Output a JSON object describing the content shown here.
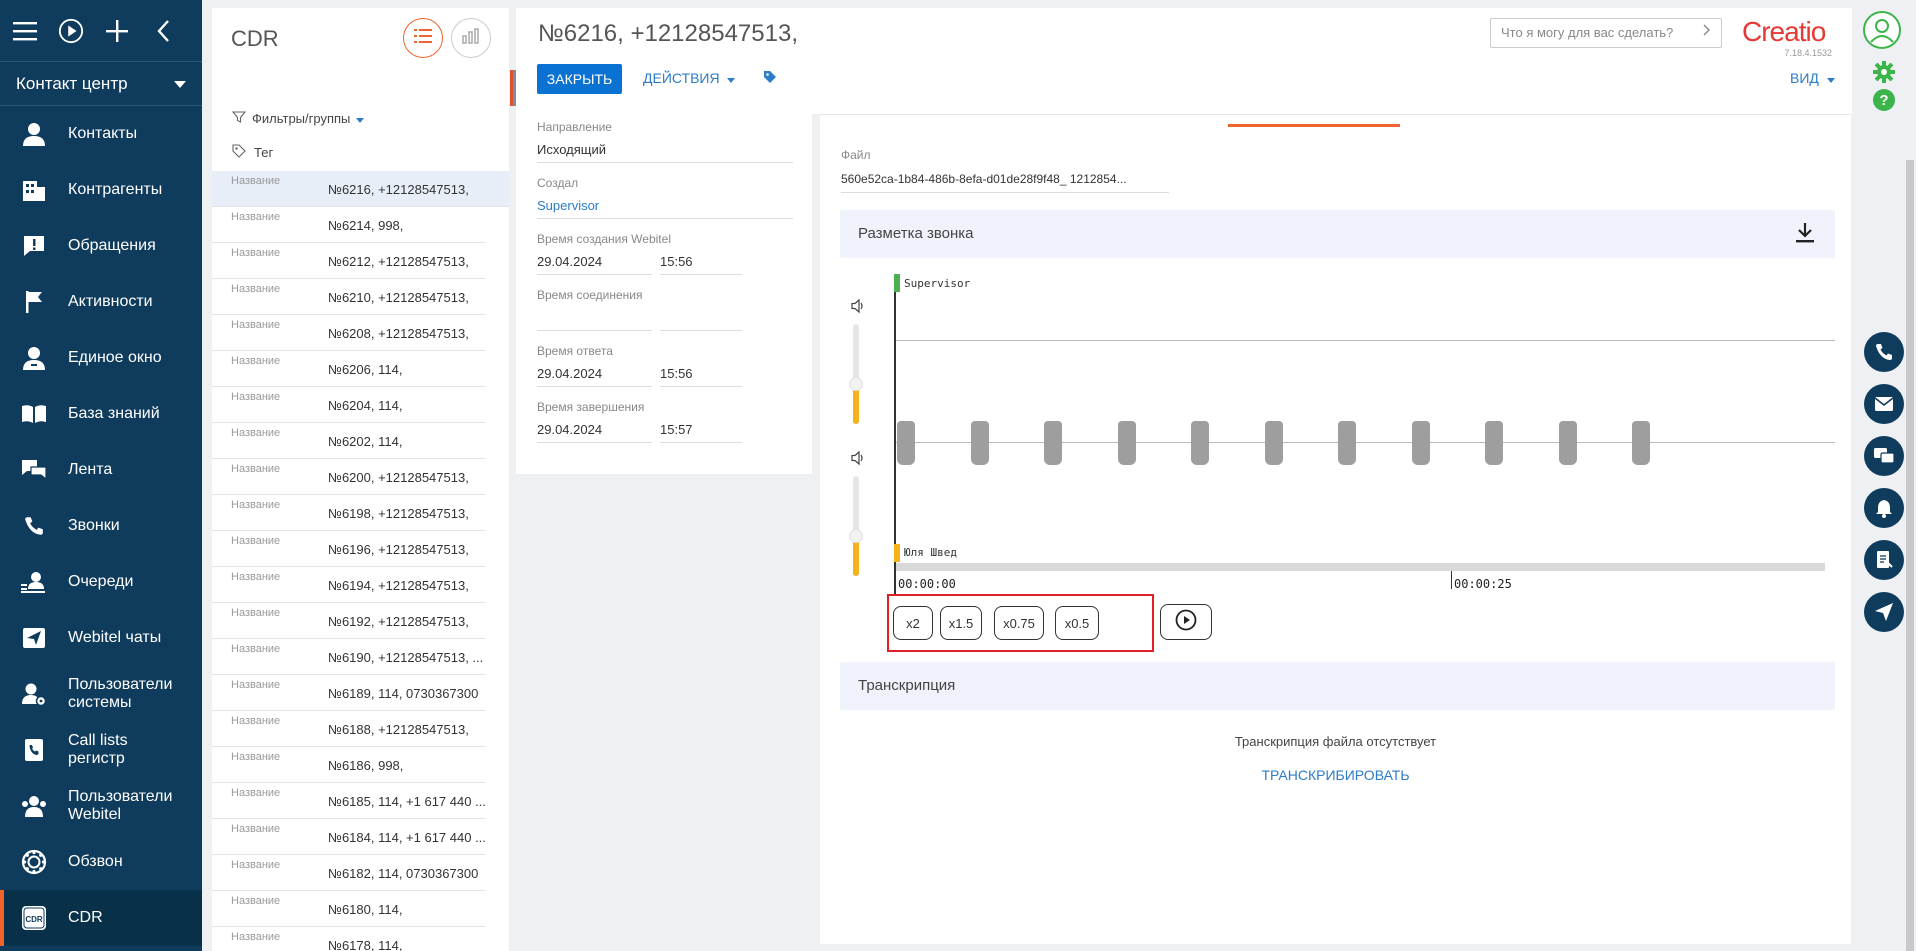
{
  "nav": {
    "section": "Контакт центр",
    "items": [
      {
        "label": "Контакты",
        "icon": "person-icon"
      },
      {
        "label": "Контрагенты",
        "icon": "building-icon"
      },
      {
        "label": "Обращения",
        "icon": "alert-icon"
      },
      {
        "label": "Активности",
        "icon": "flag-icon"
      },
      {
        "label": "Единое окно",
        "icon": "person-desk-icon"
      },
      {
        "label": "База знаний",
        "icon": "book-icon"
      },
      {
        "label": "Лента",
        "icon": "chat-icon"
      },
      {
        "label": "Звонки",
        "icon": "phone-icon"
      },
      {
        "label": "Очереди",
        "icon": "queue-icon"
      },
      {
        "label": "Webitel чаты",
        "icon": "send-icon"
      },
      {
        "label": "Пользователи системы",
        "icon": "user-system-icon"
      },
      {
        "label": "Call lists регистр",
        "icon": "call-list-icon"
      },
      {
        "label": "Пользователи Webitel",
        "icon": "users-icon"
      },
      {
        "label": "Обзвон",
        "icon": "dial-icon"
      },
      {
        "label": "CDR",
        "icon": "cdr-icon"
      }
    ]
  },
  "list": {
    "title": "CDR",
    "filters_label": "Фильтры/группы",
    "tag_label": "Тег",
    "row_label": "Название",
    "rows": [
      "№6216, +12128547513,",
      "№6214, 998,",
      "№6212, +12128547513,",
      "№6210, +12128547513,",
      "№6208, +12128547513,",
      "№6206, 114,",
      "№6204, 114,",
      "№6202, 114,",
      "№6200, +12128547513,",
      "№6198, +12128547513,",
      "№6196, +12128547513,",
      "№6194, +12128547513,",
      "№6192, +12128547513,",
      "№6190, +12128547513, ...",
      "№6189, 114, 0730367300",
      "№6188, +12128547513,",
      "№6186, 998,",
      "№6185, 114, +1 617 440 ...",
      "№6184, 114, +1 617 440 ...",
      "№6182, 114, 0730367300",
      "№6180, 114,",
      "№6178, 114,"
    ]
  },
  "header": {
    "title": "№6216, +12128547513,",
    "close_label": "ЗАКРЫТЬ",
    "actions_label": "ДЕЙСТВИЯ",
    "search_placeholder": "Что я могу для вас сделать?",
    "brand": "Creatio",
    "version": "7.18.4.1532",
    "view_label": "ВИД"
  },
  "details": {
    "direction_label": "Направление",
    "direction_value": "Исходящий",
    "created_by_label": "Создал",
    "created_by_value": "Supervisor",
    "webitel_created_label": "Время создания Webitel",
    "webitel_created_date": "29.04.2024",
    "webitel_created_time": "15:56",
    "connect_label": "Время соединения",
    "connect_date": "",
    "connect_time": "",
    "answer_label": "Время ответа",
    "answer_date": "29.04.2024",
    "answer_time": "15:56",
    "end_label": "Время завершения",
    "end_date": "29.04.2024",
    "end_time": "15:57"
  },
  "content": {
    "file_label": "Файл",
    "file_value": "560e52ca-1b84-486b-8efa-d01de28f9f48_ 1212854...",
    "markup_title": "Разметка звонка",
    "track_top_label": "Supervisor",
    "track_bottom_label": "Юля Швед",
    "time_start": "00:00:00",
    "time_mid": "00:00:25",
    "speeds": [
      "x2",
      "x1.5",
      "x0.75",
      "x0.5"
    ],
    "transcription_title": "Транскрипция",
    "no_transcription": "Транскрипция файла отсутствует",
    "transcribe_label": "ТРАНСКРИБИРОВАТЬ",
    "volume_top_level": 0.4,
    "volume_bottom_level": 0.4
  },
  "colors": {
    "nav_bg": "#0f3b5c",
    "accent": "#f0632a",
    "primary": "#0a72d3",
    "link": "#2d7cc8",
    "track_top": "#4caf50",
    "track_bottom": "#f5b21b",
    "highlight": "#e31e24"
  }
}
